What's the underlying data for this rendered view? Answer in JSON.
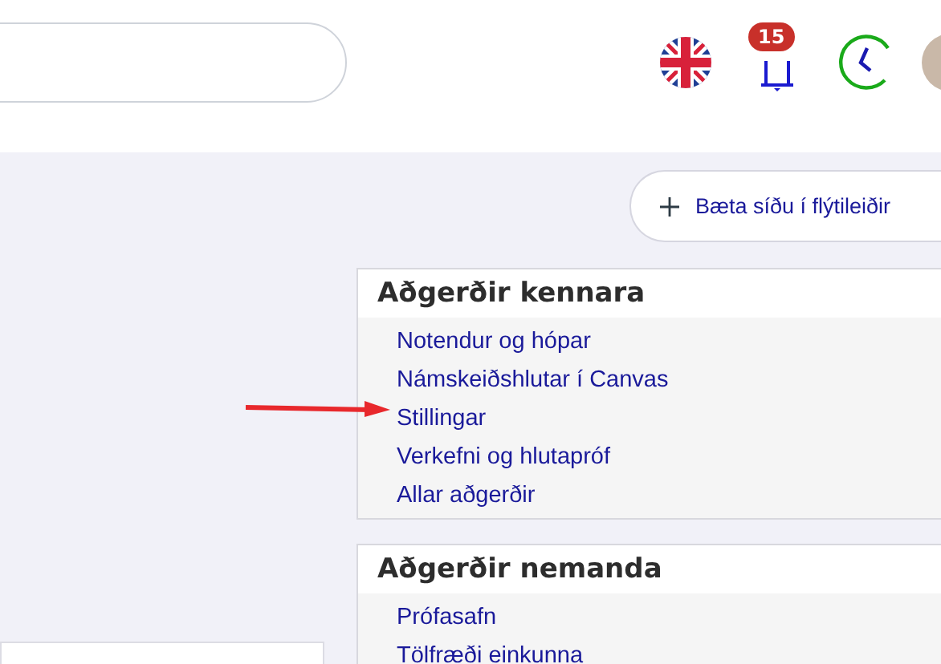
{
  "header": {
    "notifications": {
      "count": "15"
    }
  },
  "shortcut_button": {
    "label": "Bæta síðu í flýtileiðir"
  },
  "panels": [
    {
      "title": "Aðgerðir kennara",
      "links": [
        "Notendur og hópar",
        "Námskeiðshlutar í Canvas",
        "Stillingar",
        "Verkefni og hlutapróf",
        "Allar aðgerðir"
      ]
    },
    {
      "title": "Aðgerðir nemanda",
      "links": [
        "Prófasafn",
        "Tölfræði einkunna"
      ]
    }
  ]
}
